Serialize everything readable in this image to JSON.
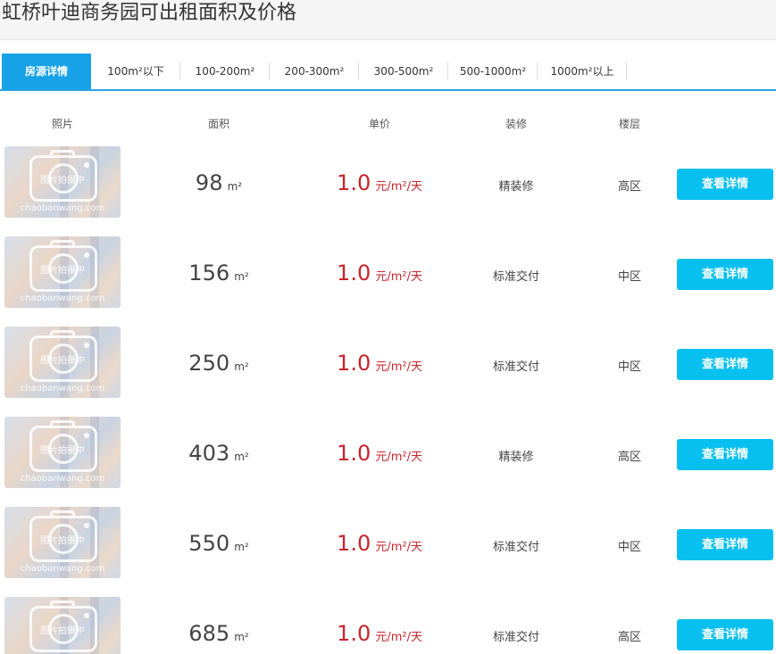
{
  "page": {
    "title": "虹桥叶迪商务园可出租面积及价格"
  },
  "tabs": [
    {
      "label": "房源详情",
      "active": true
    },
    {
      "label": "100m²以下"
    },
    {
      "label": "100-200m²"
    },
    {
      "label": "200-300m²"
    },
    {
      "label": "300-500m²"
    },
    {
      "label": "500-1000m²"
    },
    {
      "label": "1000m²以上"
    }
  ],
  "table": {
    "headers": {
      "photo": "照片",
      "area": "面积",
      "price": "单价",
      "decoration": "装修",
      "floor": "楼层"
    },
    "thumb_text": "图片拍摄中",
    "thumb_watermark": "chaobanwang.com",
    "area_unit": "m²",
    "price_unit": "元/m²/天",
    "detail_label": "查看详情",
    "rows": [
      {
        "area": "98",
        "price": "1.0",
        "decoration": "精装修",
        "floor": "高区"
      },
      {
        "area": "156",
        "price": "1.0",
        "decoration": "标准交付",
        "floor": "中区"
      },
      {
        "area": "250",
        "price": "1.0",
        "decoration": "标准交付",
        "floor": "中区"
      },
      {
        "area": "403",
        "price": "1.0",
        "decoration": "精装修",
        "floor": "高区"
      },
      {
        "area": "550",
        "price": "1.0",
        "decoration": "标准交付",
        "floor": "中区"
      },
      {
        "area": "685",
        "price": "1.0",
        "decoration": "标准交付",
        "floor": "高区"
      }
    ]
  },
  "colors": {
    "accent": "#17a2e8",
    "button": "#07c0f0",
    "price": "#c8242c"
  }
}
